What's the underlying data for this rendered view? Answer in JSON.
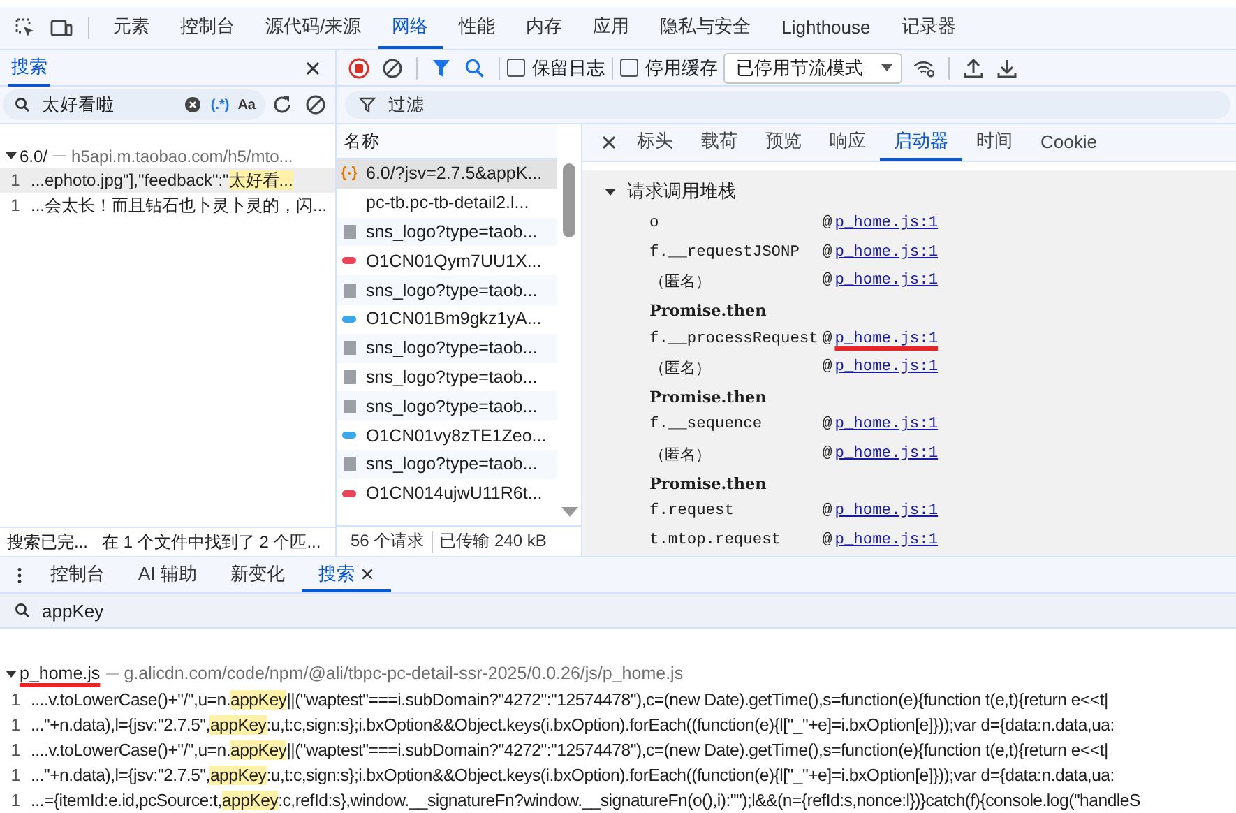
{
  "main_tabs": [
    {
      "label": "元素",
      "selected": false
    },
    {
      "label": "控制台",
      "selected": false
    },
    {
      "label": "源代码/来源",
      "selected": false
    },
    {
      "label": "网络",
      "selected": true
    },
    {
      "label": "性能",
      "selected": false
    },
    {
      "label": "内存",
      "selected": false
    },
    {
      "label": "应用",
      "selected": false
    },
    {
      "label": "隐私与安全",
      "selected": false
    },
    {
      "label": "Lighthouse",
      "selected": false
    },
    {
      "label": "记录器",
      "selected": false
    }
  ],
  "search_panel": {
    "title": "搜索",
    "query": "太好看啦",
    "regex_toggle": "(.*)",
    "case_toggle": "Aa",
    "results": [
      {
        "file": "6.0/",
        "url": "h5api.m.taobao.com/h5/mto...",
        "expanded": true,
        "matches": [
          {
            "line": "1",
            "before": "...ephoto.jpg\"],\"feedback\":\"",
            "match": "太好看...",
            "selected": true
          },
          {
            "line": "1",
            "before": "...会太长！而且钻石也卜灵卜灵的，闪...",
            "selected": false
          }
        ]
      }
    ],
    "status": "搜索已完...",
    "summary": "在 1 个文件中找到了 2 个匹..."
  },
  "network": {
    "recording": true,
    "preserve_log": {
      "label": "保留日志",
      "checked": false
    },
    "disable_cache": {
      "label": "停用缓存",
      "checked": false
    },
    "throttling": "已停用节流模式",
    "filter_placeholder": "过滤",
    "column": "名称",
    "requests": [
      {
        "name": "6.0/?jsv=2.7.5&appK...",
        "kind": "script",
        "selected": true
      },
      {
        "name": "pc-tb.pc-tb-detail2.l...",
        "kind": "none",
        "selected": false
      },
      {
        "name": "sns_logo?type=taob...",
        "kind": "image",
        "selected": false
      },
      {
        "name": "O1CN01Qym7UU1X...",
        "kind": "pill",
        "color": "#e8455a",
        "selected": false
      },
      {
        "name": "sns_logo?type=taob...",
        "kind": "image",
        "selected": false
      },
      {
        "name": "O1CN01Bm9gkz1yA...",
        "kind": "pill",
        "color": "#3aa7e8",
        "selected": false
      },
      {
        "name": "sns_logo?type=taob...",
        "kind": "image",
        "selected": false
      },
      {
        "name": "sns_logo?type=taob...",
        "kind": "image",
        "selected": false
      },
      {
        "name": "sns_logo?type=taob...",
        "kind": "image",
        "selected": false
      },
      {
        "name": "O1CN01vy8zTE1Zeo...",
        "kind": "pill",
        "color": "#3aa7e8",
        "selected": false
      },
      {
        "name": "sns_logo?type=taob...",
        "kind": "image",
        "selected": false
      },
      {
        "name": "O1CN014ujwU11R6t...",
        "kind": "pill",
        "color": "#e8455a",
        "selected": false
      }
    ],
    "request_count": "56 个请求",
    "transferred": "已传输 240 kB",
    "detail_tabs": [
      {
        "label": "标头",
        "selected": false
      },
      {
        "label": "载荷",
        "selected": false
      },
      {
        "label": "预览",
        "selected": false
      },
      {
        "label": "响应",
        "selected": false
      },
      {
        "label": "启动器",
        "selected": true
      },
      {
        "label": "时间",
        "selected": false
      },
      {
        "label": "Cookie",
        "selected": false
      }
    ],
    "stack_title": "请求调用堆栈",
    "stack_expanded": true,
    "stack": [
      {
        "kind": "call",
        "fn": "o",
        "at": "@",
        "link": "p_home.js:1"
      },
      {
        "kind": "call",
        "fn": "f.__requestJSONP",
        "at": "@",
        "link": "p_home.js:1"
      },
      {
        "kind": "call",
        "fn": "（匿名）",
        "at": "@",
        "link": "p_home.js:1"
      },
      {
        "kind": "async",
        "fn": "Promise.then"
      },
      {
        "kind": "call",
        "fn": "f.__processRequest",
        "at": "@",
        "link": "p_home.js:1",
        "marked": true
      },
      {
        "kind": "call",
        "fn": "（匿名）",
        "at": "@",
        "link": "p_home.js:1"
      },
      {
        "kind": "async",
        "fn": "Promise.then"
      },
      {
        "kind": "call",
        "fn": "f.__sequence",
        "at": "@",
        "link": "p_home.js:1"
      },
      {
        "kind": "call",
        "fn": "（匿名）",
        "at": "@",
        "link": "p_home.js:1"
      },
      {
        "kind": "async",
        "fn": "Promise.then"
      },
      {
        "kind": "call",
        "fn": "f.request",
        "at": "@",
        "link": "p_home.js:1"
      },
      {
        "kind": "call",
        "fn": "t.mtop.request",
        "at": "@",
        "link": "p_home.js:1"
      }
    ]
  },
  "drawer": {
    "tabs": [
      {
        "label": "控制台",
        "selected": false,
        "closable": false
      },
      {
        "label": "AI 辅助",
        "selected": false,
        "closable": false
      },
      {
        "label": "新变化",
        "selected": false,
        "closable": false
      },
      {
        "label": "搜索",
        "selected": true,
        "closable": true
      }
    ],
    "query": "appKey",
    "results": [
      {
        "file": "p_home.js",
        "marked": true,
        "url": "g.alicdn.com/code/npm/@ali/tbpc-pc-detail-ssr-2025/0.0.26/js/p_home.js",
        "expanded": true,
        "matches": [
          {
            "line": "1",
            "before": "....v.toLowerCase()+\"/\",u=n.",
            "match": "appKey",
            "after": "||(\"waptest\"===i.subDomain?\"4272\":\"12574478\"),c=(new Date).getTime(),s=function(e){function t(e,t){return e<<t|"
          },
          {
            "line": "1",
            "before": "...\"+n.data),l={jsv:\"2.7.5\",",
            "match": "appKey",
            "after": ":u,t:c,sign:s};i.bxOption&&Object.keys(i.bxOption).forEach((function(e){l[\"_\"+e]=i.bxOption[e]}));var d={data:n.data,ua:"
          },
          {
            "line": "1",
            "before": "....v.toLowerCase()+\"/\",u=n.",
            "match": "appKey",
            "after": "||(\"waptest\"===i.subDomain?\"4272\":\"12574478\"),c=(new Date).getTime(),s=function(e){function t(e,t){return e<<t|"
          },
          {
            "line": "1",
            "before": "...\"+n.data),l={jsv:\"2.7.5\",",
            "match": "appKey",
            "after": ":u,t:c,sign:s};i.bxOption&&Object.keys(i.bxOption).forEach((function(e){l[\"_\"+e]=i.bxOption[e]}));var d={data:n.data,ua:"
          },
          {
            "line": "1",
            "before": "...={itemId:e.id,pcSource:t,",
            "match": "appKey",
            "after": ":c,refId:s},window.__signatureFn?window.__signatureFn(o(),i):\"\");l&&(n={refId:s,nonce:l})}catch(f){console.log(\"handleS"
          }
        ]
      }
    ]
  }
}
